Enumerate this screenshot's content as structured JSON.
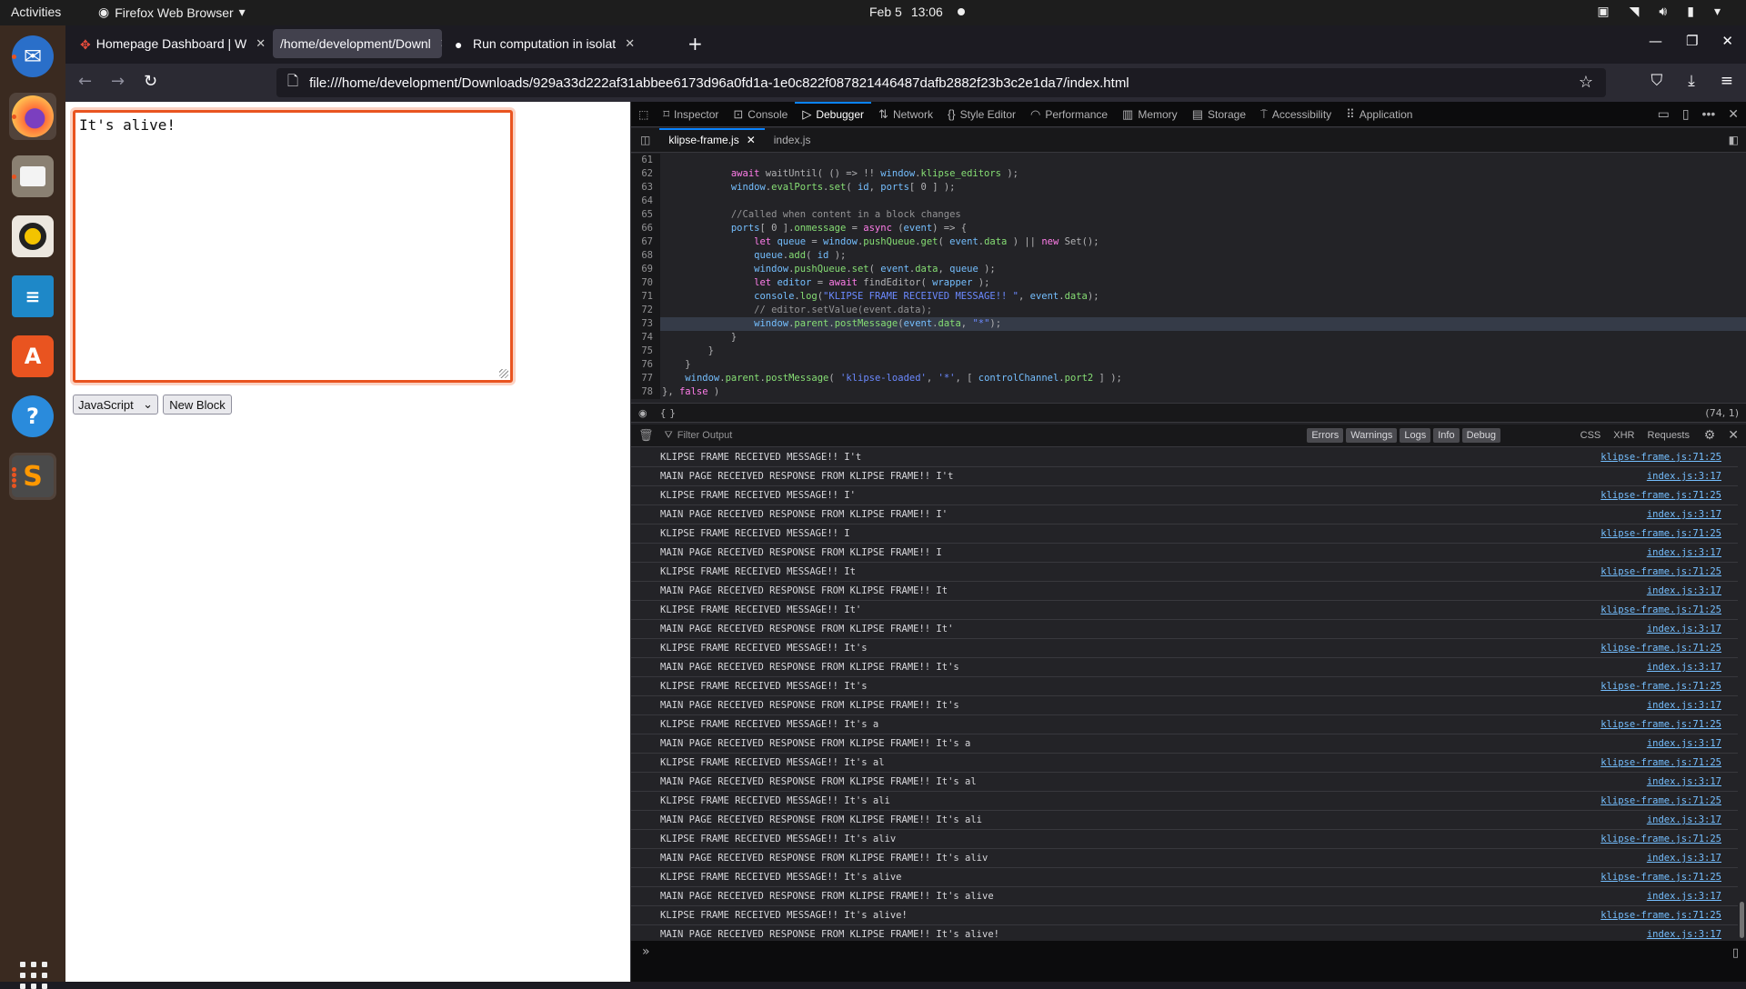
{
  "topbar": {
    "activities": "Activities",
    "app_name": "Firefox Web Browser",
    "date": "Feb 5",
    "time": "13:06"
  },
  "dock": {
    "items": [
      {
        "name": "thunderbird",
        "running": true
      },
      {
        "name": "firefox",
        "running": true,
        "active": true
      },
      {
        "name": "files",
        "running": true
      },
      {
        "name": "rhythmbox",
        "running": false
      },
      {
        "name": "libreoffice-writer",
        "running": false
      },
      {
        "name": "ubuntu-software",
        "running": false
      },
      {
        "name": "help",
        "running": false
      },
      {
        "name": "sublime-text",
        "running": true
      }
    ]
  },
  "browser": {
    "tabs": [
      {
        "label": "Homepage Dashboard | W",
        "selected": false
      },
      {
        "label": "/home/development/Downl",
        "selected": true
      },
      {
        "label": "Run computation in isolat",
        "selected": false
      }
    ],
    "url": "file:///home/development/Downloads/929a33d222af31abbee6173d96a0fd1a-1e0c822f087821446487dafb2882f23b3c2e1da7/index.html"
  },
  "page": {
    "editor_value": "It's alive!",
    "language_select": "JavaScript",
    "new_block_label": "New Block"
  },
  "devtools": {
    "tabs": [
      "Inspector",
      "Console",
      "Debugger",
      "Network",
      "Style Editor",
      "Performance",
      "Memory",
      "Storage",
      "Accessibility",
      "Application"
    ],
    "selected_tab": "Debugger",
    "source_tabs": [
      "klipse-frame.js",
      "index.js"
    ],
    "selected_source": "klipse-frame.js",
    "cursor_position": "(74, 1)",
    "braces_label": "{ }",
    "code_lines": [
      {
        "n": "61",
        "text": ""
      },
      {
        "n": "62",
        "text": "            await waitUntil( () => !! window.klipse_editors );"
      },
      {
        "n": "63",
        "text": "            window.evalPorts.set( id, ports[ 0 ] );"
      },
      {
        "n": "64",
        "text": ""
      },
      {
        "n": "65",
        "text": "            //Called when content in a block changes"
      },
      {
        "n": "66",
        "text": "            ports[ 0 ].onmessage = async (event) => {"
      },
      {
        "n": "67",
        "text": "                let queue = window.pushQueue.get( event.data ) || new Set();"
      },
      {
        "n": "68",
        "text": "                queue.add( id );"
      },
      {
        "n": "69",
        "text": "                window.pushQueue.set( event.data, queue );"
      },
      {
        "n": "70",
        "text": "                let editor = await findEditor( wrapper );"
      },
      {
        "n": "71",
        "text": "                console.log(\"KLIPSE FRAME RECEIVED MESSAGE!! \", event.data);"
      },
      {
        "n": "72",
        "text": "                // editor.setValue(event.data);"
      },
      {
        "n": "73",
        "text": "                window.parent.postMessage(event.data, \"*\");"
      },
      {
        "n": "74",
        "text": "            }"
      },
      {
        "n": "75",
        "text": "        }"
      },
      {
        "n": "76",
        "text": "    }"
      },
      {
        "n": "77",
        "text": "    window.parent.postMessage( 'klipse-loaded', '*', [ controlChannel.port2 ] );"
      },
      {
        "n": "78",
        "text": "}, false )"
      }
    ],
    "highlighted_line": "73",
    "console": {
      "filter_placeholder": "Filter Output",
      "levels": [
        "Errors",
        "Warnings",
        "Logs",
        "Info",
        "Debug"
      ],
      "categories": [
        "CSS",
        "XHR",
        "Requests"
      ],
      "messages": [
        {
          "text": "KLIPSE FRAME RECEIVED MESSAGE!!  I't",
          "loc": "klipse-frame.js:71:25"
        },
        {
          "text": "MAIN PAGE RECEIVED RESPONSE FROM KLIPSE FRAME!!  I't",
          "loc": "index.js:3:17"
        },
        {
          "text": "KLIPSE FRAME RECEIVED MESSAGE!!  I'",
          "loc": "klipse-frame.js:71:25"
        },
        {
          "text": "MAIN PAGE RECEIVED RESPONSE FROM KLIPSE FRAME!!  I'",
          "loc": "index.js:3:17"
        },
        {
          "text": "KLIPSE FRAME RECEIVED MESSAGE!!  I",
          "loc": "klipse-frame.js:71:25"
        },
        {
          "text": "MAIN PAGE RECEIVED RESPONSE FROM KLIPSE FRAME!!  I",
          "loc": "index.js:3:17"
        },
        {
          "text": "KLIPSE FRAME RECEIVED MESSAGE!!  It",
          "loc": "klipse-frame.js:71:25"
        },
        {
          "text": "MAIN PAGE RECEIVED RESPONSE FROM KLIPSE FRAME!!  It",
          "loc": "index.js:3:17"
        },
        {
          "text": "KLIPSE FRAME RECEIVED MESSAGE!!  It'",
          "loc": "klipse-frame.js:71:25"
        },
        {
          "text": "MAIN PAGE RECEIVED RESPONSE FROM KLIPSE FRAME!!  It'",
          "loc": "index.js:3:17"
        },
        {
          "text": "KLIPSE FRAME RECEIVED MESSAGE!!  It's",
          "loc": "klipse-frame.js:71:25"
        },
        {
          "text": "MAIN PAGE RECEIVED RESPONSE FROM KLIPSE FRAME!!  It's",
          "loc": "index.js:3:17"
        },
        {
          "text": "KLIPSE FRAME RECEIVED MESSAGE!!  It's",
          "loc": "klipse-frame.js:71:25"
        },
        {
          "text": "MAIN PAGE RECEIVED RESPONSE FROM KLIPSE FRAME!!  It's",
          "loc": "index.js:3:17"
        },
        {
          "text": "KLIPSE FRAME RECEIVED MESSAGE!!  It's a",
          "loc": "klipse-frame.js:71:25"
        },
        {
          "text": "MAIN PAGE RECEIVED RESPONSE FROM KLIPSE FRAME!!  It's a",
          "loc": "index.js:3:17"
        },
        {
          "text": "KLIPSE FRAME RECEIVED MESSAGE!!  It's al",
          "loc": "klipse-frame.js:71:25"
        },
        {
          "text": "MAIN PAGE RECEIVED RESPONSE FROM KLIPSE FRAME!!  It's al",
          "loc": "index.js:3:17"
        },
        {
          "text": "KLIPSE FRAME RECEIVED MESSAGE!!  It's ali",
          "loc": "klipse-frame.js:71:25"
        },
        {
          "text": "MAIN PAGE RECEIVED RESPONSE FROM KLIPSE FRAME!!  It's ali",
          "loc": "index.js:3:17"
        },
        {
          "text": "KLIPSE FRAME RECEIVED MESSAGE!!  It's aliv",
          "loc": "klipse-frame.js:71:25"
        },
        {
          "text": "MAIN PAGE RECEIVED RESPONSE FROM KLIPSE FRAME!!  It's aliv",
          "loc": "index.js:3:17"
        },
        {
          "text": "KLIPSE FRAME RECEIVED MESSAGE!!  It's alive",
          "loc": "klipse-frame.js:71:25"
        },
        {
          "text": "MAIN PAGE RECEIVED RESPONSE FROM KLIPSE FRAME!!  It's alive",
          "loc": "index.js:3:17"
        },
        {
          "text": "KLIPSE FRAME RECEIVED MESSAGE!!  It's alive!",
          "loc": "klipse-frame.js:71:25"
        },
        {
          "text": "MAIN PAGE RECEIVED RESPONSE FROM KLIPSE FRAME!!  It's alive!",
          "loc": "index.js:3:17"
        }
      ],
      "prompt": "»"
    }
  }
}
